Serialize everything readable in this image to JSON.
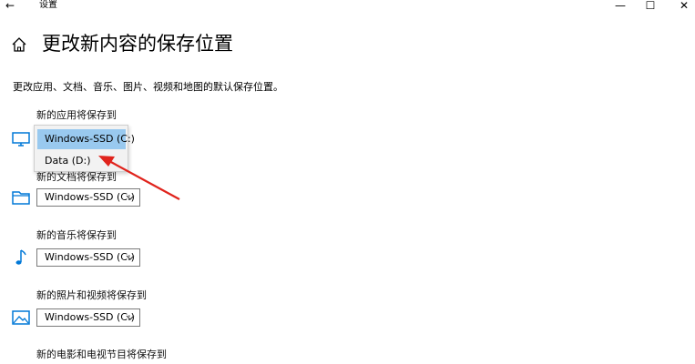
{
  "window": {
    "title": "设置",
    "back_icon": "←",
    "min_icon": "—",
    "max_icon": "☐",
    "close_icon": "✕"
  },
  "page": {
    "title": "更改新内容的保存位置",
    "description": "更改应用、文档、音乐、图片、视频和地图的默认保存位置。"
  },
  "sections": [
    {
      "label": "新的应用将保存到",
      "icon": "monitor-icon",
      "value": "Windows-SSD (C:)"
    },
    {
      "label": "新的文档将保存到",
      "icon": "folder-icon",
      "value": "Windows-SSD (C:)"
    },
    {
      "label": "新的音乐将保存到",
      "icon": "music-note-icon",
      "value": "Windows-SSD (C:)"
    },
    {
      "label": "新的照片和视频将保存到",
      "icon": "photo-icon",
      "value": "Windows-SSD (C:)"
    },
    {
      "label": "新的电影和电视节目将保存到",
      "icon": "movie-icon",
      "value": ""
    }
  ],
  "dropdown": {
    "options": [
      "Windows-SSD (C:)",
      "Data (D:)"
    ],
    "selected": "Windows-SSD (C:)"
  },
  "colors": {
    "accent_blue": "#0078d7",
    "selection": "#99c9ef",
    "arrow_red": "#e0231c"
  }
}
